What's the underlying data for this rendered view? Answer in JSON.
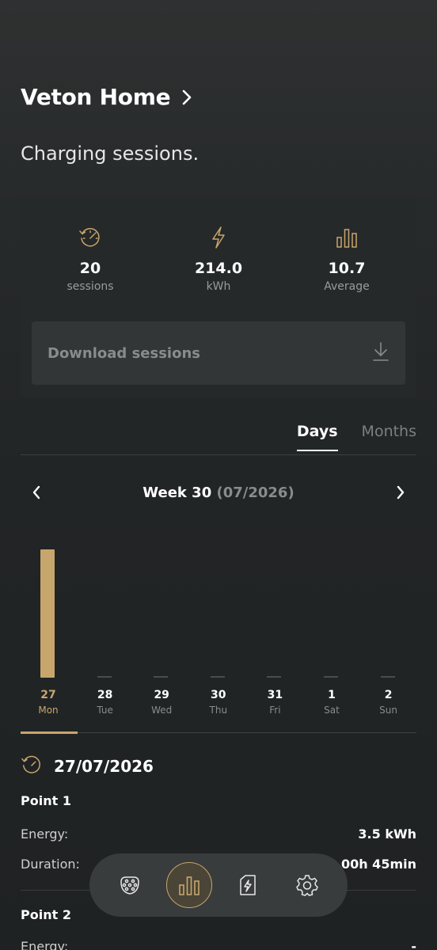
{
  "header": {
    "title": "Veton Home"
  },
  "subtitle": "Charging sessions.",
  "stats": [
    {
      "icon": "history-gauge-icon",
      "value": "20",
      "label": "sessions"
    },
    {
      "icon": "lightning-icon",
      "value": "214.0",
      "label": "kWh"
    },
    {
      "icon": "bar-chart-icon",
      "value": "10.7",
      "label": "Average"
    }
  ],
  "download": {
    "label": "Download sessions",
    "icon": "download-icon"
  },
  "tabs": [
    {
      "label": "Days",
      "active": true
    },
    {
      "label": "Months",
      "active": false
    }
  ],
  "week": {
    "title": "Week 30",
    "range": "(07/2026)"
  },
  "chart_data": {
    "type": "bar",
    "categories": [
      "27",
      "28",
      "29",
      "30",
      "31",
      "1",
      "2"
    ],
    "day_names": [
      "Mon",
      "Tue",
      "Wed",
      "Thu",
      "Fri",
      "Sat",
      "Sun"
    ],
    "values": [
      10.3,
      0,
      0,
      0,
      0,
      0,
      0
    ],
    "selected_index": 0,
    "ylim": [
      0,
      10.7
    ],
    "bar_color": "#c7a66d"
  },
  "detail": {
    "date": "27/07/2026",
    "points": [
      {
        "title": "Point 1",
        "rows": [
          {
            "k": "Energy:",
            "v": "3.5 kWh"
          },
          {
            "k": "Duration:",
            "v": "00h 45min"
          }
        ]
      },
      {
        "title": "Point 2",
        "rows": [
          {
            "k": "Energy:",
            "v": "-"
          }
        ]
      }
    ]
  },
  "bottom_nav": [
    {
      "name": "charger-connector-icon",
      "active": false
    },
    {
      "name": "bar-chart-icon",
      "active": true
    },
    {
      "name": "charging-station-icon",
      "active": false
    },
    {
      "name": "gear-icon",
      "active": false
    }
  ],
  "colors": {
    "accent": "#c7a66d",
    "background": "#222526",
    "card": "#262929"
  }
}
